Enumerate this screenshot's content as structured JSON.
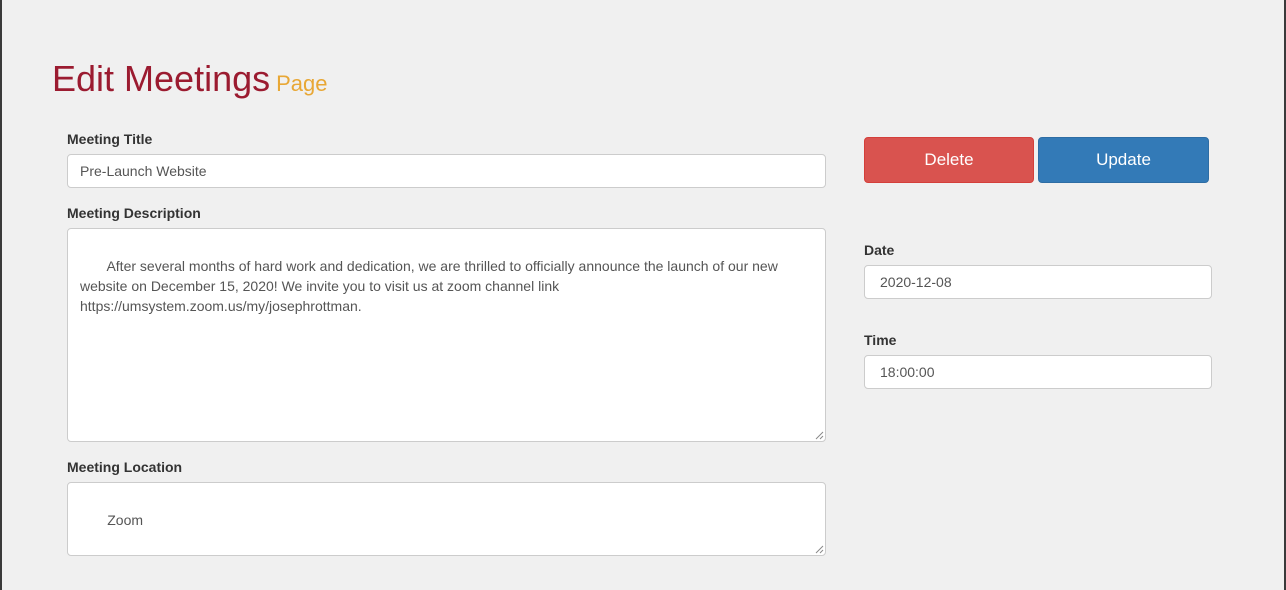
{
  "header": {
    "title": "Edit Meetings",
    "subtitle": "Page"
  },
  "form": {
    "meeting_title": {
      "label": "Meeting Title",
      "value": "Pre-Launch Website"
    },
    "meeting_description": {
      "label": "Meeting Description",
      "value": "     After several months of hard work and dedication, we are thrilled to officially announce the launch of our new website on December 15, 2020! We invite you to visit us at zoom channel link https://umsystem.zoom.us/my/josephrottman."
    },
    "meeting_location": {
      "label": "Meeting Location",
      "value": "     Zoom"
    },
    "date": {
      "label": "Date",
      "value": "2020-12-08"
    },
    "time": {
      "label": "Time",
      "value": "18:00:00"
    }
  },
  "actions": {
    "delete_label": "Delete",
    "update_label": "Update"
  },
  "colors": {
    "title": "#9b1b30",
    "subtitle": "#e8a735",
    "delete": "#d9534f",
    "update": "#337ab7",
    "background": "#f0f0f0"
  }
}
